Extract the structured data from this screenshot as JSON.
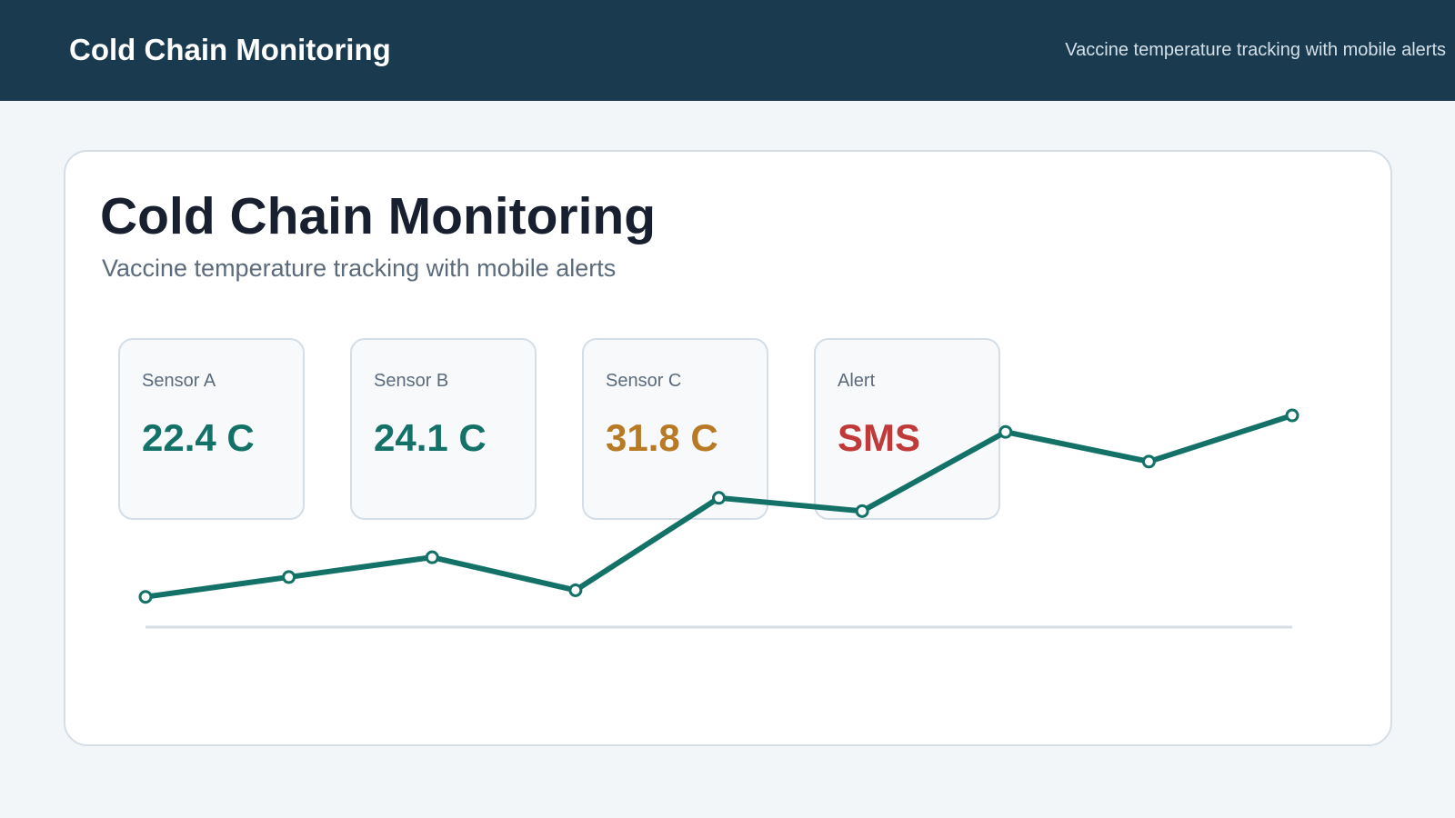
{
  "header": {
    "title": "Cold Chain Monitoring",
    "subtitle": "Vaccine temperature tracking with mobile alerts"
  },
  "main": {
    "title": "Cold Chain Monitoring",
    "subtitle": "Vaccine temperature tracking with mobile alerts"
  },
  "cards": [
    {
      "label": "Sensor A",
      "value": "22.4 C",
      "color": "#137168"
    },
    {
      "label": "Sensor B",
      "value": "24.1 C",
      "color": "#137168"
    },
    {
      "label": "Sensor C",
      "value": "31.8 C",
      "color": "#b87a24"
    },
    {
      "label": "Alert",
      "value": "SMS",
      "color": "#c03a3a"
    }
  ],
  "colors": {
    "header_bg": "#1a3a4f",
    "line": "#137168",
    "baseline": "#d5dde5"
  },
  "chart_data": {
    "type": "line",
    "title": "",
    "xlabel": "",
    "ylabel": "",
    "x": [
      1,
      2,
      3,
      4,
      5,
      6,
      7,
      8,
      9
    ],
    "ylim": [
      0,
      100
    ],
    "series": [
      {
        "values": [
          10,
          16,
          22,
          12,
          40,
          36,
          60,
          51,
          65
        ]
      }
    ],
    "grid": false,
    "legend": "none",
    "axes_visible": false
  }
}
